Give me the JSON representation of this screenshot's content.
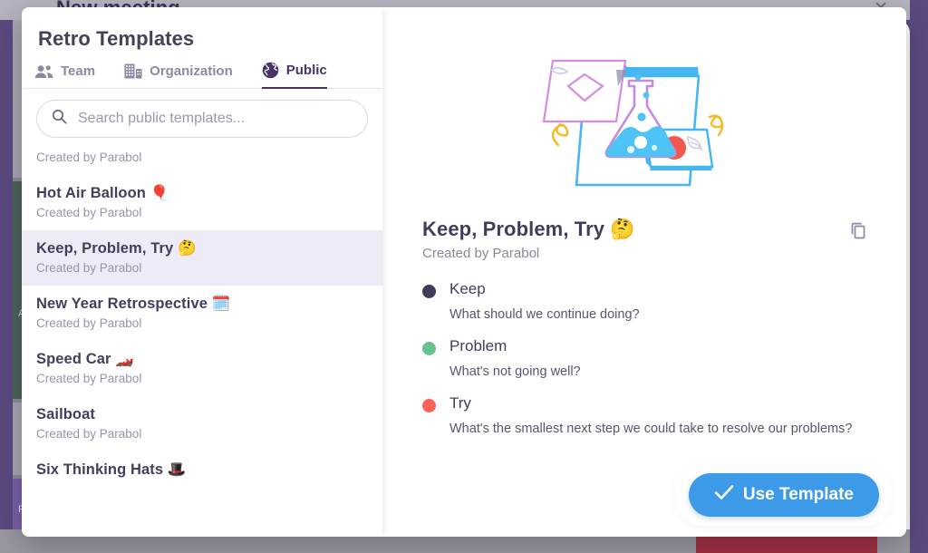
{
  "background": {
    "page_title": "New meeting",
    "close_icon": "close-icon",
    "card_labels": {
      "green": "A",
      "purple": "R"
    }
  },
  "modal": {
    "title": "Retro Templates",
    "tabs": [
      {
        "label": "Team",
        "icon": "people-icon",
        "active": false
      },
      {
        "label": "Organization",
        "icon": "building-icon",
        "active": false
      },
      {
        "label": "Public",
        "icon": "globe-icon",
        "active": true
      }
    ],
    "search": {
      "placeholder": "Search public templates...",
      "value": "",
      "icon": "search-icon"
    },
    "templates": [
      {
        "name": "",
        "author": "Created by Parabol",
        "selected": false,
        "clipped": true
      },
      {
        "name": "Hot Air Balloon 🎈",
        "author": "Created by Parabol",
        "selected": false,
        "clipped": false
      },
      {
        "name": "Keep, Problem, Try 🤔",
        "author": "Created by Parabol",
        "selected": true,
        "clipped": false
      },
      {
        "name": "New Year Retrospective 🗓️",
        "author": "Created by Parabol",
        "selected": false,
        "clipped": false
      },
      {
        "name": "Speed Car 🏎️",
        "author": "Created by Parabol",
        "selected": false,
        "clipped": false
      },
      {
        "name": "Sailboat",
        "author": "Created by Parabol",
        "selected": false,
        "clipped": false
      },
      {
        "name": "Six Thinking Hats 🎩",
        "author": "",
        "selected": false,
        "clipped": false
      }
    ],
    "detail": {
      "illustration": "science-flask-illustration",
      "title": "Keep, Problem, Try 🤔",
      "author": "Created by Parabol",
      "copy_icon": "copy-icon",
      "prompts": [
        {
          "title": "Keep",
          "question": "What should we continue doing?",
          "color": "#3e3c57"
        },
        {
          "title": "Problem",
          "question": "What's not going well?",
          "color": "#66c28f"
        },
        {
          "title": "Try",
          "question": "What's the smallest next step we could take to resolve our problems?",
          "color": "#fd6157"
        }
      ]
    },
    "cta": {
      "label": "Use Template",
      "icon": "check-icon",
      "color": "#3c9ae8"
    }
  },
  "colors": {
    "accent_purple": "#493267",
    "selected_row": "#edebf5",
    "cta_blue": "#3c9ae8",
    "rail_purple": "#5c4a80",
    "card_green": "#4a6459"
  }
}
